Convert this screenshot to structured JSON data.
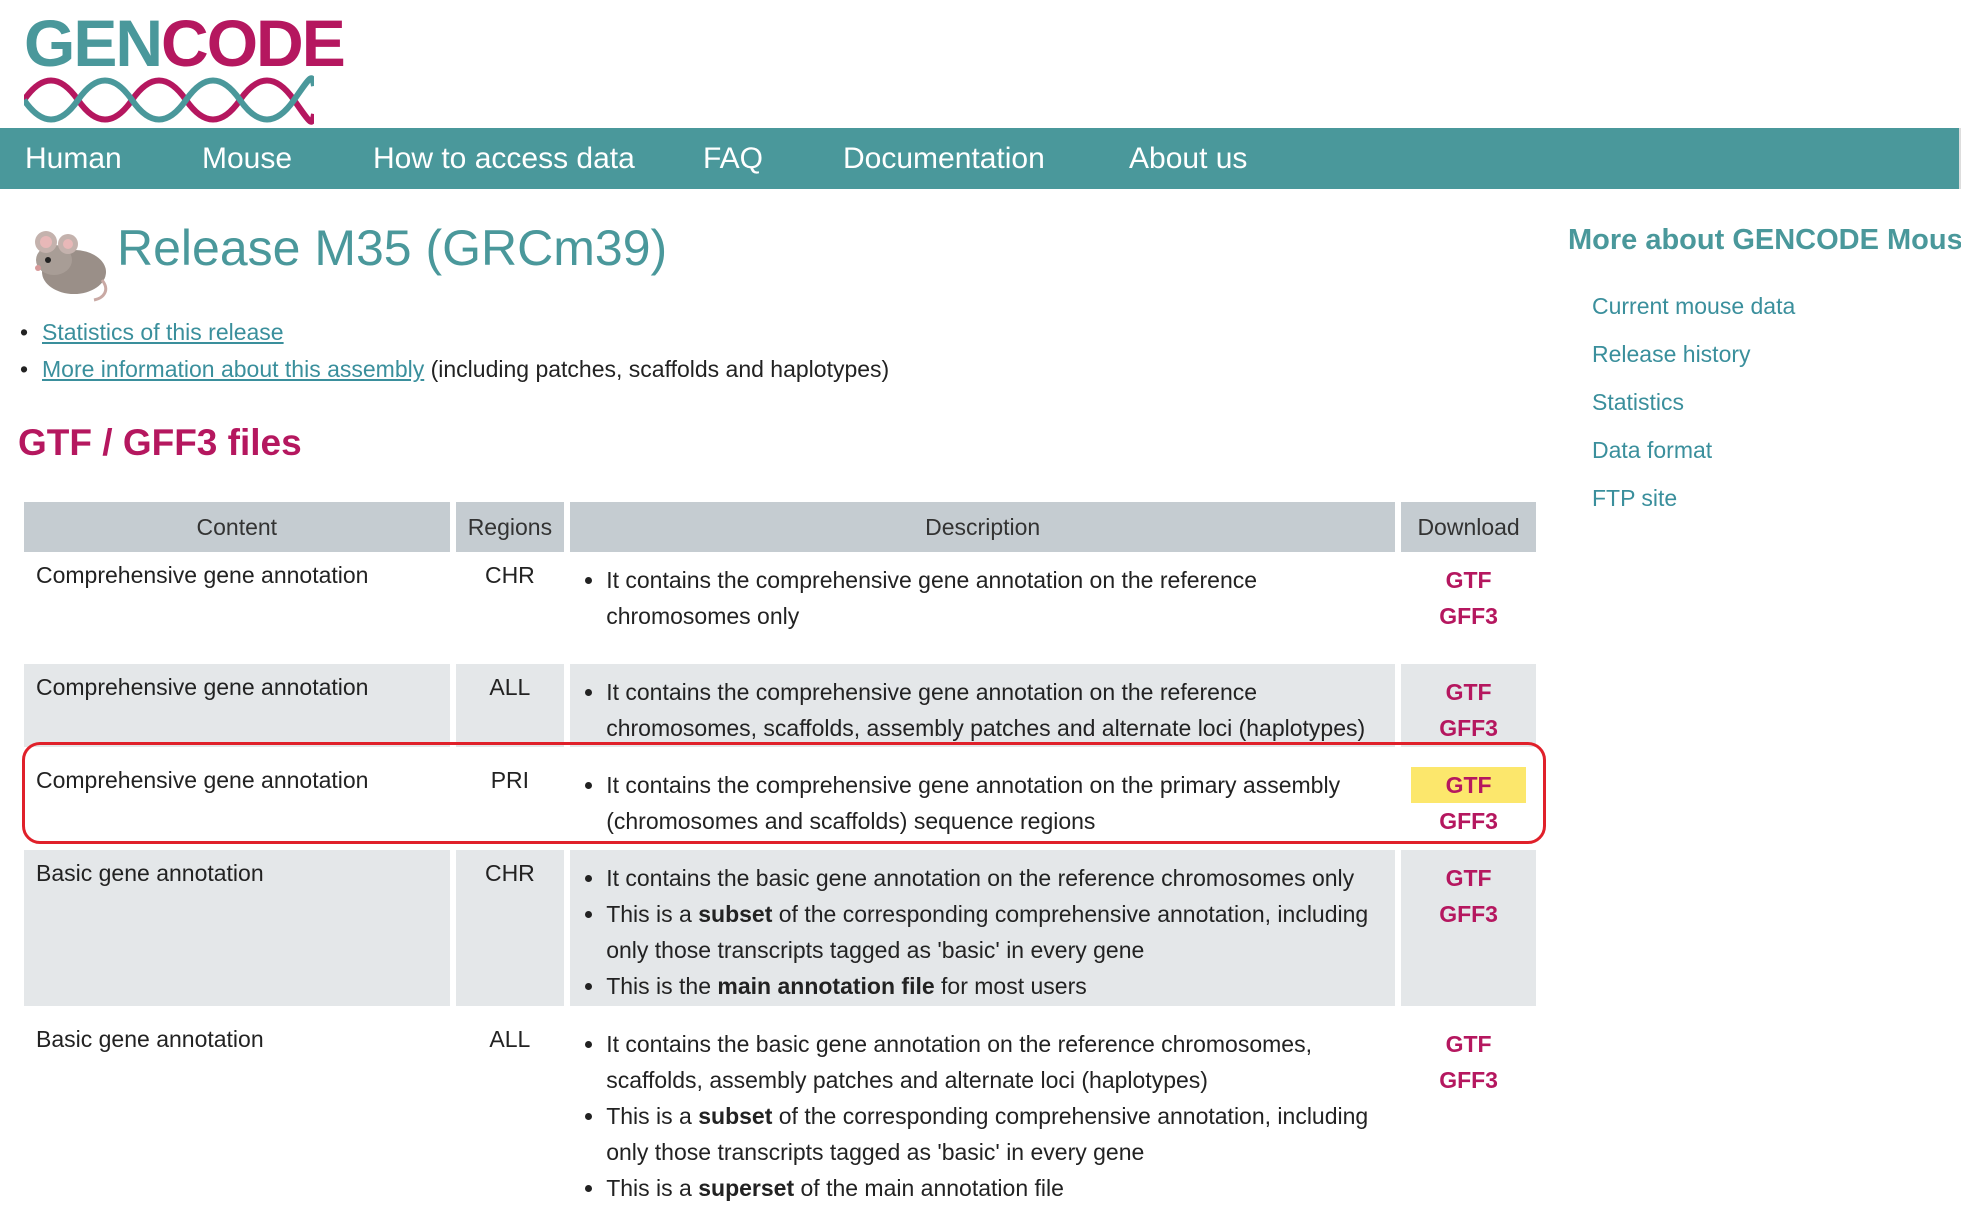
{
  "logo": {
    "part1": "GEN",
    "part2": "CODE"
  },
  "nav": [
    "Human",
    "Mouse",
    "How to access data",
    "FAQ",
    "Documentation",
    "About us"
  ],
  "page": {
    "title": "Release M35 (GRCm39)",
    "links": [
      {
        "link": "Statistics of this release",
        "suffix": ""
      },
      {
        "link": "More information about this assembly",
        "suffix": " (including patches, scaffolds and haplotypes)"
      }
    ],
    "section_title": "GTF / GFF3 files"
  },
  "table": {
    "headers": [
      "Content",
      "Regions",
      "Description",
      "Download"
    ],
    "rows": [
      {
        "content": "Comprehensive gene annotation",
        "region": "CHR",
        "desc": [
          "It contains the comprehensive gene annotation on the reference chromosomes only"
        ],
        "gtf": "GTF",
        "gff3": "GFF3"
      },
      {
        "content": "Comprehensive gene annotation",
        "region": "ALL",
        "desc": [
          "It contains the comprehensive gene annotation on the reference chromosomes, scaffolds, assembly patches and alternate loci (haplotypes)"
        ],
        "gtf": "GTF",
        "gff3": "GFF3"
      },
      {
        "content": "Comprehensive gene annotation",
        "region": "PRI",
        "desc": [
          "It contains the comprehensive gene annotation on the primary assembly (chromosomes and scaffolds) sequence regions"
        ],
        "gtf": "GTF",
        "gff3": "GFF3"
      },
      {
        "content": "Basic gene annotation",
        "region": "CHR",
        "desc1": "It contains the basic gene annotation on the reference chromosomes only",
        "desc2_pre": "This is a ",
        "desc2_bold": "subset",
        "desc2_post": " of the corresponding comprehensive annotation, including only those transcripts tagged as 'basic' in every gene",
        "desc3_pre": "This is the ",
        "desc3_bold": "main annotation file",
        "desc3_post": " for most users",
        "gtf": "GTF",
        "gff3": "GFF3"
      },
      {
        "content": "Basic gene annotation",
        "region": "ALL",
        "desc1": "It contains the basic gene annotation on the reference chromosomes, scaffolds, assembly patches and alternate loci (haplotypes)",
        "desc2_pre": "This is a ",
        "desc2_bold": "subset",
        "desc2_post": " of the corresponding comprehensive annotation, including only those transcripts tagged as 'basic' in every gene",
        "desc3_pre": "This is a ",
        "desc3_bold": "superset",
        "desc3_post": " of the main annotation file",
        "gtf": "GTF",
        "gff3": "GFF3"
      }
    ]
  },
  "sidebar": {
    "title": "More about GENCODE Mouse",
    "links": [
      "Current mouse data",
      "Release history",
      "Statistics",
      "Data format",
      "FTP site"
    ]
  },
  "colors": {
    "teal": "#4a989b",
    "magenta": "#b5175f",
    "highlight": "#fce76c",
    "annotation_box": "#e0202a"
  }
}
